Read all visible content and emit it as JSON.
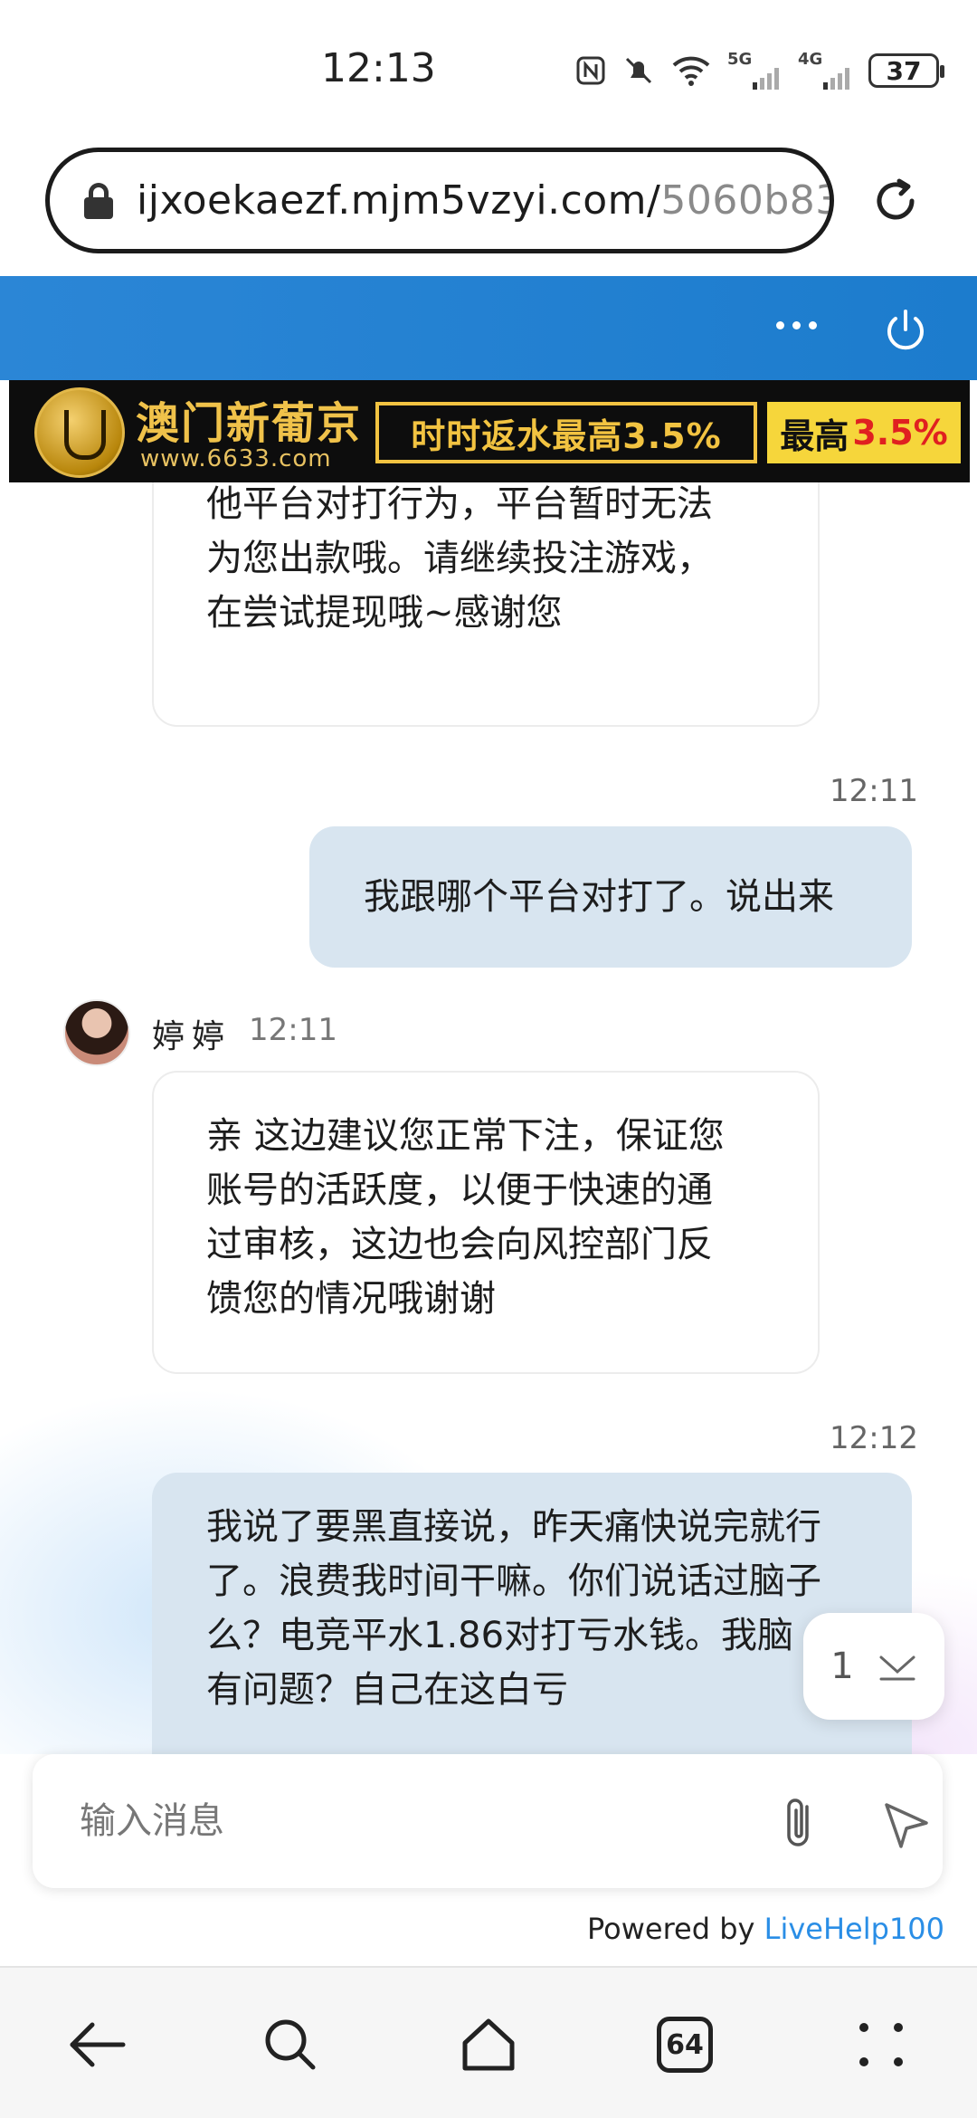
{
  "status_bar": {
    "time": "12:13",
    "network_1": "5G",
    "network_2": "4G",
    "battery": "37",
    "icons": [
      "nfc-icon",
      "mute-icon",
      "wifi-icon",
      "signal-icon",
      "battery-icon"
    ]
  },
  "browser": {
    "url_domain": "ijxoekaezf.mjm5vzyi.com/",
    "url_path": "5060b83",
    "tabs_count": "64"
  },
  "banner": {
    "name": "澳门新葡京",
    "site": "www.6633.com",
    "promo": "时时返水最高3.5%",
    "promo2_label": "最高",
    "promo2_value": "3.5%"
  },
  "chat": {
    "agent_name": "婷婷",
    "messages": [
      {
        "from": "agent",
        "lines": [
          "他平台对打行为，平台暂时无法",
          "为您出款哦。请继续投注游戏，",
          "在尝试提现哦~感谢您"
        ]
      },
      {
        "from": "user",
        "time": "12:11",
        "text": "我跟哪个平台对打了。说出来"
      },
      {
        "from": "agent",
        "time": "12:11",
        "lines": [
          "亲 这边建议您正常下注，保证您",
          "账号的活跃度，以便于快速的通",
          "过审核，这边也会向风控部门反",
          "馈您的情况哦谢谢"
        ]
      },
      {
        "from": "user",
        "time": "12:12",
        "lines": [
          "我说了要黑直接说，昨天痛快说完就行",
          "了。浪费我时间干嘛。你们说话过脑子",
          "么？电竞平水1.86对打亏水钱。我脑",
          "有问题？自己在这白亏"
        ]
      }
    ],
    "unread_count": "1"
  },
  "input": {
    "placeholder": "输入消息"
  },
  "footer": {
    "powered_prefix": "Powered by ",
    "powered_brand": "LiveHelp100"
  },
  "colors": {
    "header_blue": "#1c7ccd",
    "user_bubble": "#d8e5f0",
    "brand_link": "#2a8ee6"
  }
}
